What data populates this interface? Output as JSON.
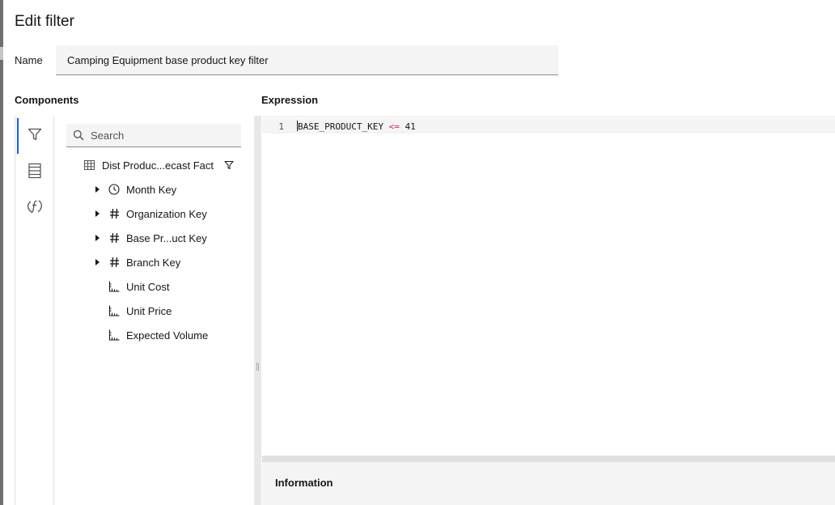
{
  "dialog": {
    "title": "Edit filter"
  },
  "name_field": {
    "label": "Name",
    "value": "Camping Equipment base product key filter"
  },
  "components": {
    "title": "Components",
    "rail": [
      {
        "name": "filter-tab",
        "icon": "filter-icon",
        "active": true
      },
      {
        "name": "data-tab",
        "icon": "data-table-icon",
        "active": false
      },
      {
        "name": "functions-tab",
        "icon": "function-icon",
        "active": false
      }
    ],
    "search": {
      "placeholder": "Search",
      "value": ""
    },
    "tree": {
      "root": {
        "label": "Dist Produc...ecast Fact",
        "icon": "table-icon",
        "badge_icon": "filter-icon"
      },
      "items": [
        {
          "label": "Month Key",
          "icon": "clock-icon",
          "expandable": true
        },
        {
          "label": "Organization Key",
          "icon": "hash-icon",
          "expandable": true
        },
        {
          "label": "Base Pr...uct Key",
          "icon": "hash-icon",
          "expandable": true
        },
        {
          "label": "Branch Key",
          "icon": "hash-icon",
          "expandable": true
        },
        {
          "label": "Unit Cost",
          "icon": "measure-icon",
          "expandable": false
        },
        {
          "label": "Unit Price",
          "icon": "measure-icon",
          "expandable": false
        },
        {
          "label": "Expected Volume",
          "icon": "measure-icon",
          "expandable": false
        }
      ]
    }
  },
  "expression": {
    "title": "Expression",
    "line_number": "1",
    "code": {
      "field": "BASE_PRODUCT_KEY",
      "operator": "<=",
      "value": "41"
    }
  },
  "information": {
    "title": "Information"
  },
  "colors": {
    "accent": "#0f62fe",
    "operator": "#d12771",
    "field_bg": "#f4f4f4"
  }
}
